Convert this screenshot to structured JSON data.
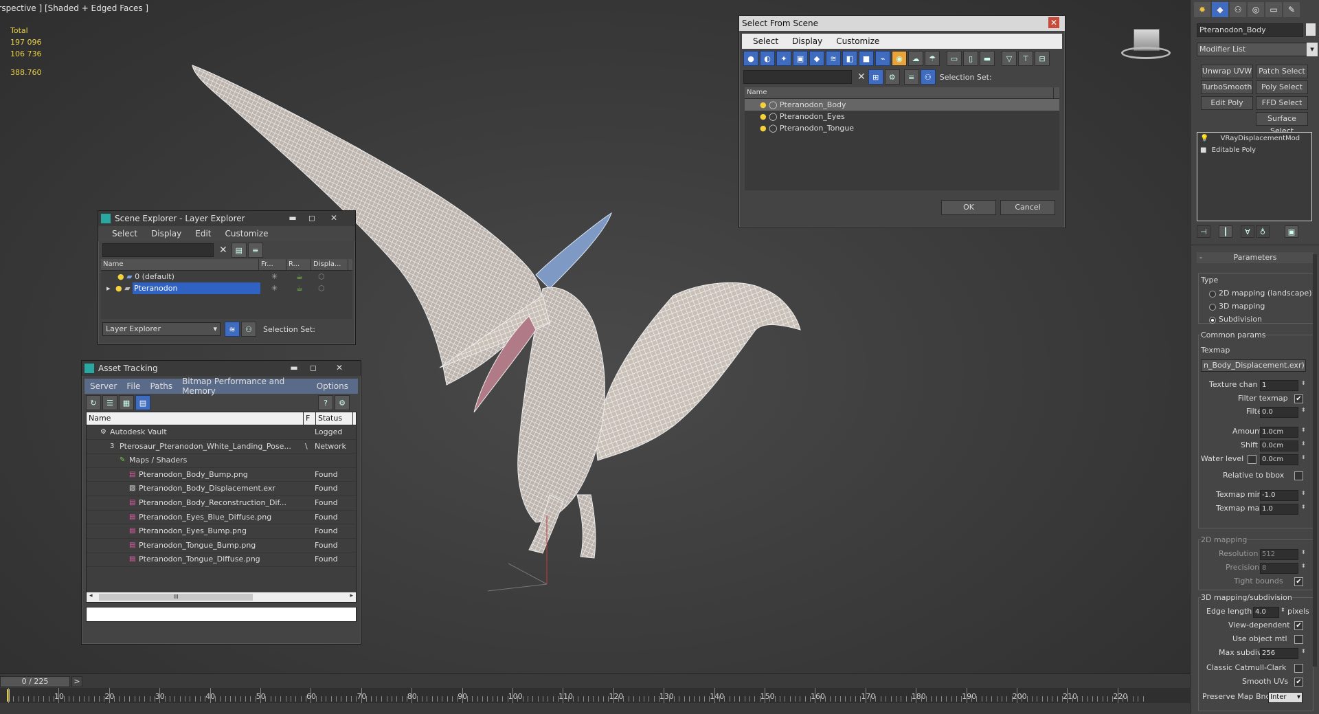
{
  "viewport": {
    "label": "erspective ] [Shaded + Edged Faces ]",
    "stats": {
      "total_label": "Total",
      "polys": "197 096",
      "verts": "106 736",
      "fps": "388.760"
    }
  },
  "scene_explorer": {
    "title": "Scene Explorer - Layer Explorer",
    "menu": [
      "Select",
      "Display",
      "Edit",
      "Customize"
    ],
    "columns": [
      "Name",
      "Fr...",
      "R...",
      "Displa..."
    ],
    "layers": [
      "0 (default)",
      "Pteranodon"
    ],
    "footer_dropdown": "Layer Explorer",
    "selection_set": "Selection Set:"
  },
  "asset_tracking": {
    "title": "Asset Tracking",
    "menu": [
      "Server",
      "File",
      "Paths",
      "Bitmap Performance and Memory",
      "Options"
    ],
    "columns": {
      "name": "Name",
      "f": "F",
      "status": "Status"
    },
    "rows": [
      {
        "name": "Autodesk Vault",
        "f": "",
        "status": "Logged",
        "indent": 20,
        "icon": "vault-icon"
      },
      {
        "name": "Pterosaur_Pteranodon_White_Landing_Pose...",
        "f": "\\",
        "status": "Network",
        "indent": 34,
        "icon": "max-file-icon"
      },
      {
        "name": "Maps / Shaders",
        "f": "",
        "status": "",
        "indent": 48,
        "icon": "maps-icon"
      },
      {
        "name": "Pteranodon_Body_Bump.png",
        "f": "",
        "status": "Found",
        "indent": 62,
        "icon": "png-icon"
      },
      {
        "name": "Pteranodon_Body_Displacement.exr",
        "f": "",
        "status": "Found",
        "indent": 62,
        "icon": "exr-icon"
      },
      {
        "name": "Pteranodon_Body_Reconstruction_Dif...",
        "f": "",
        "status": "Found",
        "indent": 62,
        "icon": "png-icon"
      },
      {
        "name": "Pteranodon_Eyes_Blue_Diffuse.png",
        "f": "",
        "status": "Found",
        "indent": 62,
        "icon": "png-icon"
      },
      {
        "name": "Pteranodon_Eyes_Bump.png",
        "f": "",
        "status": "Found",
        "indent": 62,
        "icon": "png-icon"
      },
      {
        "name": "Pteranodon_Tongue_Bump.png",
        "f": "",
        "status": "Found",
        "indent": 62,
        "icon": "png-icon"
      },
      {
        "name": "Pteranodon_Tongue_Diffuse.png",
        "f": "",
        "status": "Found",
        "indent": 62,
        "icon": "png-icon"
      }
    ],
    "scroll_thumb": "III"
  },
  "select_from_scene": {
    "title": "Select From Scene",
    "menu": [
      "Select",
      "Display",
      "Customize"
    ],
    "selection_set": "Selection Set:",
    "column": "Name",
    "objects": [
      "Pteranodon_Body",
      "Pteranodon_Eyes",
      "Pteranodon_Tongue"
    ],
    "ok": "OK",
    "cancel": "Cancel"
  },
  "command_panel": {
    "object_name": "Pteranodon_Body",
    "modifier_list": "Modifier List",
    "buttons": [
      "Unwrap UVW",
      "Patch Select",
      "TurboSmooth",
      "Poly Select",
      "Edit Poly",
      "FFD Select",
      "Surface Select"
    ],
    "stack": [
      "VRayDisplacementMod",
      "Editable Poly"
    ],
    "rollout_title": "Parameters",
    "type_label": "Type",
    "type_options": [
      "2D mapping (landscape)",
      "3D mapping",
      "Subdivision"
    ],
    "common_params": "Common params",
    "texmap_label": "Texmap",
    "texmap_value": "n_Body_Displacement.exr)",
    "texture_chan_label": "Texture chan",
    "texture_chan": "1",
    "filter_texmap": "Filter texmap",
    "filter_blur_label": "Filter blur",
    "filter_blur": "0.0",
    "amount_label": "Amount",
    "amount": "1.0cm",
    "shift_label": "Shift",
    "shift": "0.0cm",
    "water_level_label": "Water level",
    "water_level": "0.0cm",
    "relative_bbox": "Relative to bbox",
    "texmap_min_label": "Texmap min",
    "texmap_min": "-1.0",
    "texmap_max_label": "Texmap max",
    "texmap_max": "1.0",
    "mapping2d": "2D mapping",
    "resolution_label": "Resolution",
    "resolution": "512",
    "precision_label": "Precision",
    "precision": "8",
    "tight_bounds": "Tight bounds",
    "mapping3d": "3D mapping/subdivision",
    "edge_length_label": "Edge length",
    "edge_length": "4.0",
    "pixels": "pixels",
    "view_dependent": "View-dependent",
    "use_object_mtl": "Use object mtl",
    "max_subdivs_label": "Max subdivs",
    "max_subdivs": "256",
    "classic_catmull": "Classic Catmull-Clark",
    "smooth_uvs": "Smooth UVs",
    "preserve_map": "Preserve Map Bnd",
    "preserve_map_value": "Inter"
  },
  "timeline": {
    "frame_counter": "0 / 225",
    "arrow": ">",
    "ticks": [
      "10",
      "20",
      "30",
      "40",
      "50",
      "60",
      "70",
      "80",
      "90",
      "100",
      "110",
      "120",
      "130",
      "140",
      "150",
      "160",
      "170",
      "180",
      "190",
      "200",
      "210",
      "220"
    ]
  }
}
